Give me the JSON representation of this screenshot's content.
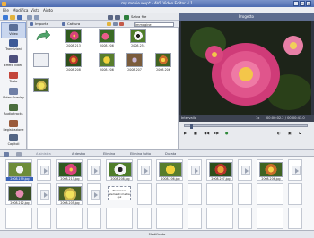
{
  "window": {
    "title": "my movie.wvp* - AVS Video Editor 4.1"
  },
  "menu": {
    "items": [
      "File",
      "Modifica",
      "Vista",
      "Aiuto"
    ]
  },
  "toolbar": {
    "project_label": "Salva file"
  },
  "sidebar": {
    "items": [
      {
        "label": "Video",
        "icon": "video-icon"
      },
      {
        "label": "Transizioni",
        "icon": "transitions-icon"
      },
      {
        "label": "Effetti video",
        "icon": "video-effects-icon"
      },
      {
        "label": "Testo",
        "icon": "text-icon"
      },
      {
        "label": "Video Overlay",
        "icon": "overlay-icon"
      },
      {
        "label": "Audio tracks",
        "icon": "audio-icon"
      },
      {
        "label": "Registrazione",
        "icon": "record-icon"
      },
      {
        "label": "Capitoli",
        "icon": "chapters-icon"
      }
    ]
  },
  "browser": {
    "import_label": "Importa",
    "capture_label": "Cattura",
    "filter_value": "Immagine",
    "items": [
      {
        "caption": "",
        "kind": "import"
      },
      {
        "caption": "2008.213",
        "kind": "flower1"
      },
      {
        "caption": "2008.206",
        "kind": "flower2"
      },
      {
        "caption": "2008.251",
        "kind": "flower3"
      },
      {
        "caption": "",
        "kind": "blank"
      },
      {
        "caption": "2008.208",
        "kind": "flower4"
      },
      {
        "caption": "2008.206",
        "kind": "flower5"
      },
      {
        "caption": "2008.207",
        "kind": "flower6"
      },
      {
        "caption": "2008.206",
        "kind": "flower7"
      },
      {
        "caption": "",
        "kind": "flower10"
      }
    ]
  },
  "preview": {
    "title": "Progetto",
    "info_left": "Intervallo",
    "info_speed": "1x",
    "info_time": "00:00:02.2 / 00:00:43.0"
  },
  "story_toolbar": {
    "buttons": [
      "A sinistra",
      "A destra",
      "Elimina",
      "Elimina tutto",
      "Durata"
    ]
  },
  "storyboard": {
    "row1": [
      {
        "caption": "2008.199.jpg",
        "kind": "flower8",
        "selected": true
      },
      {
        "caption": "2008.213.jpg",
        "kind": "flower1"
      },
      {
        "caption": "2008.208.jpg",
        "kind": "flower3"
      },
      {
        "caption": "2008.206.jpg",
        "kind": "flower5"
      },
      {
        "caption": "2008.207.jpg",
        "kind": "flower4"
      },
      {
        "caption": "2008.206.jpg",
        "kind": "flower7"
      }
    ],
    "row2": [
      {
        "caption": "2008.212.jpg",
        "kind": "flower9"
      },
      {
        "caption": "2008.205.jpg",
        "kind": "flower10"
      },
      {
        "caption": "Trascinare elementi media qui",
        "kind": "text"
      }
    ]
  },
  "statusbar": {
    "text": "Modificato"
  }
}
